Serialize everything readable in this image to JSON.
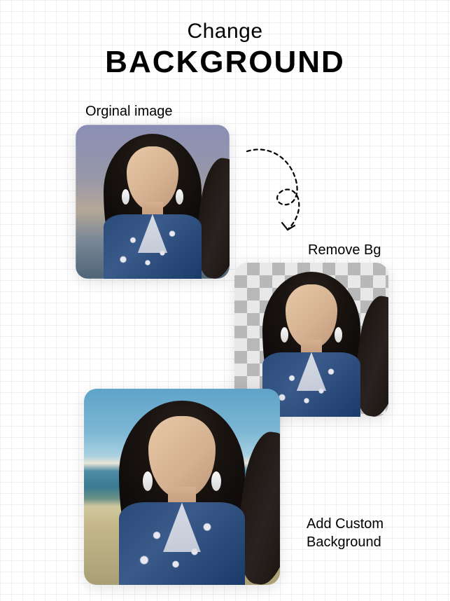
{
  "header": {
    "title_small": "Change",
    "title_large": "BACKGROUND"
  },
  "labels": {
    "original": "Orginal image",
    "remove": "Remove Bg",
    "custom": "Add Custom Background"
  }
}
